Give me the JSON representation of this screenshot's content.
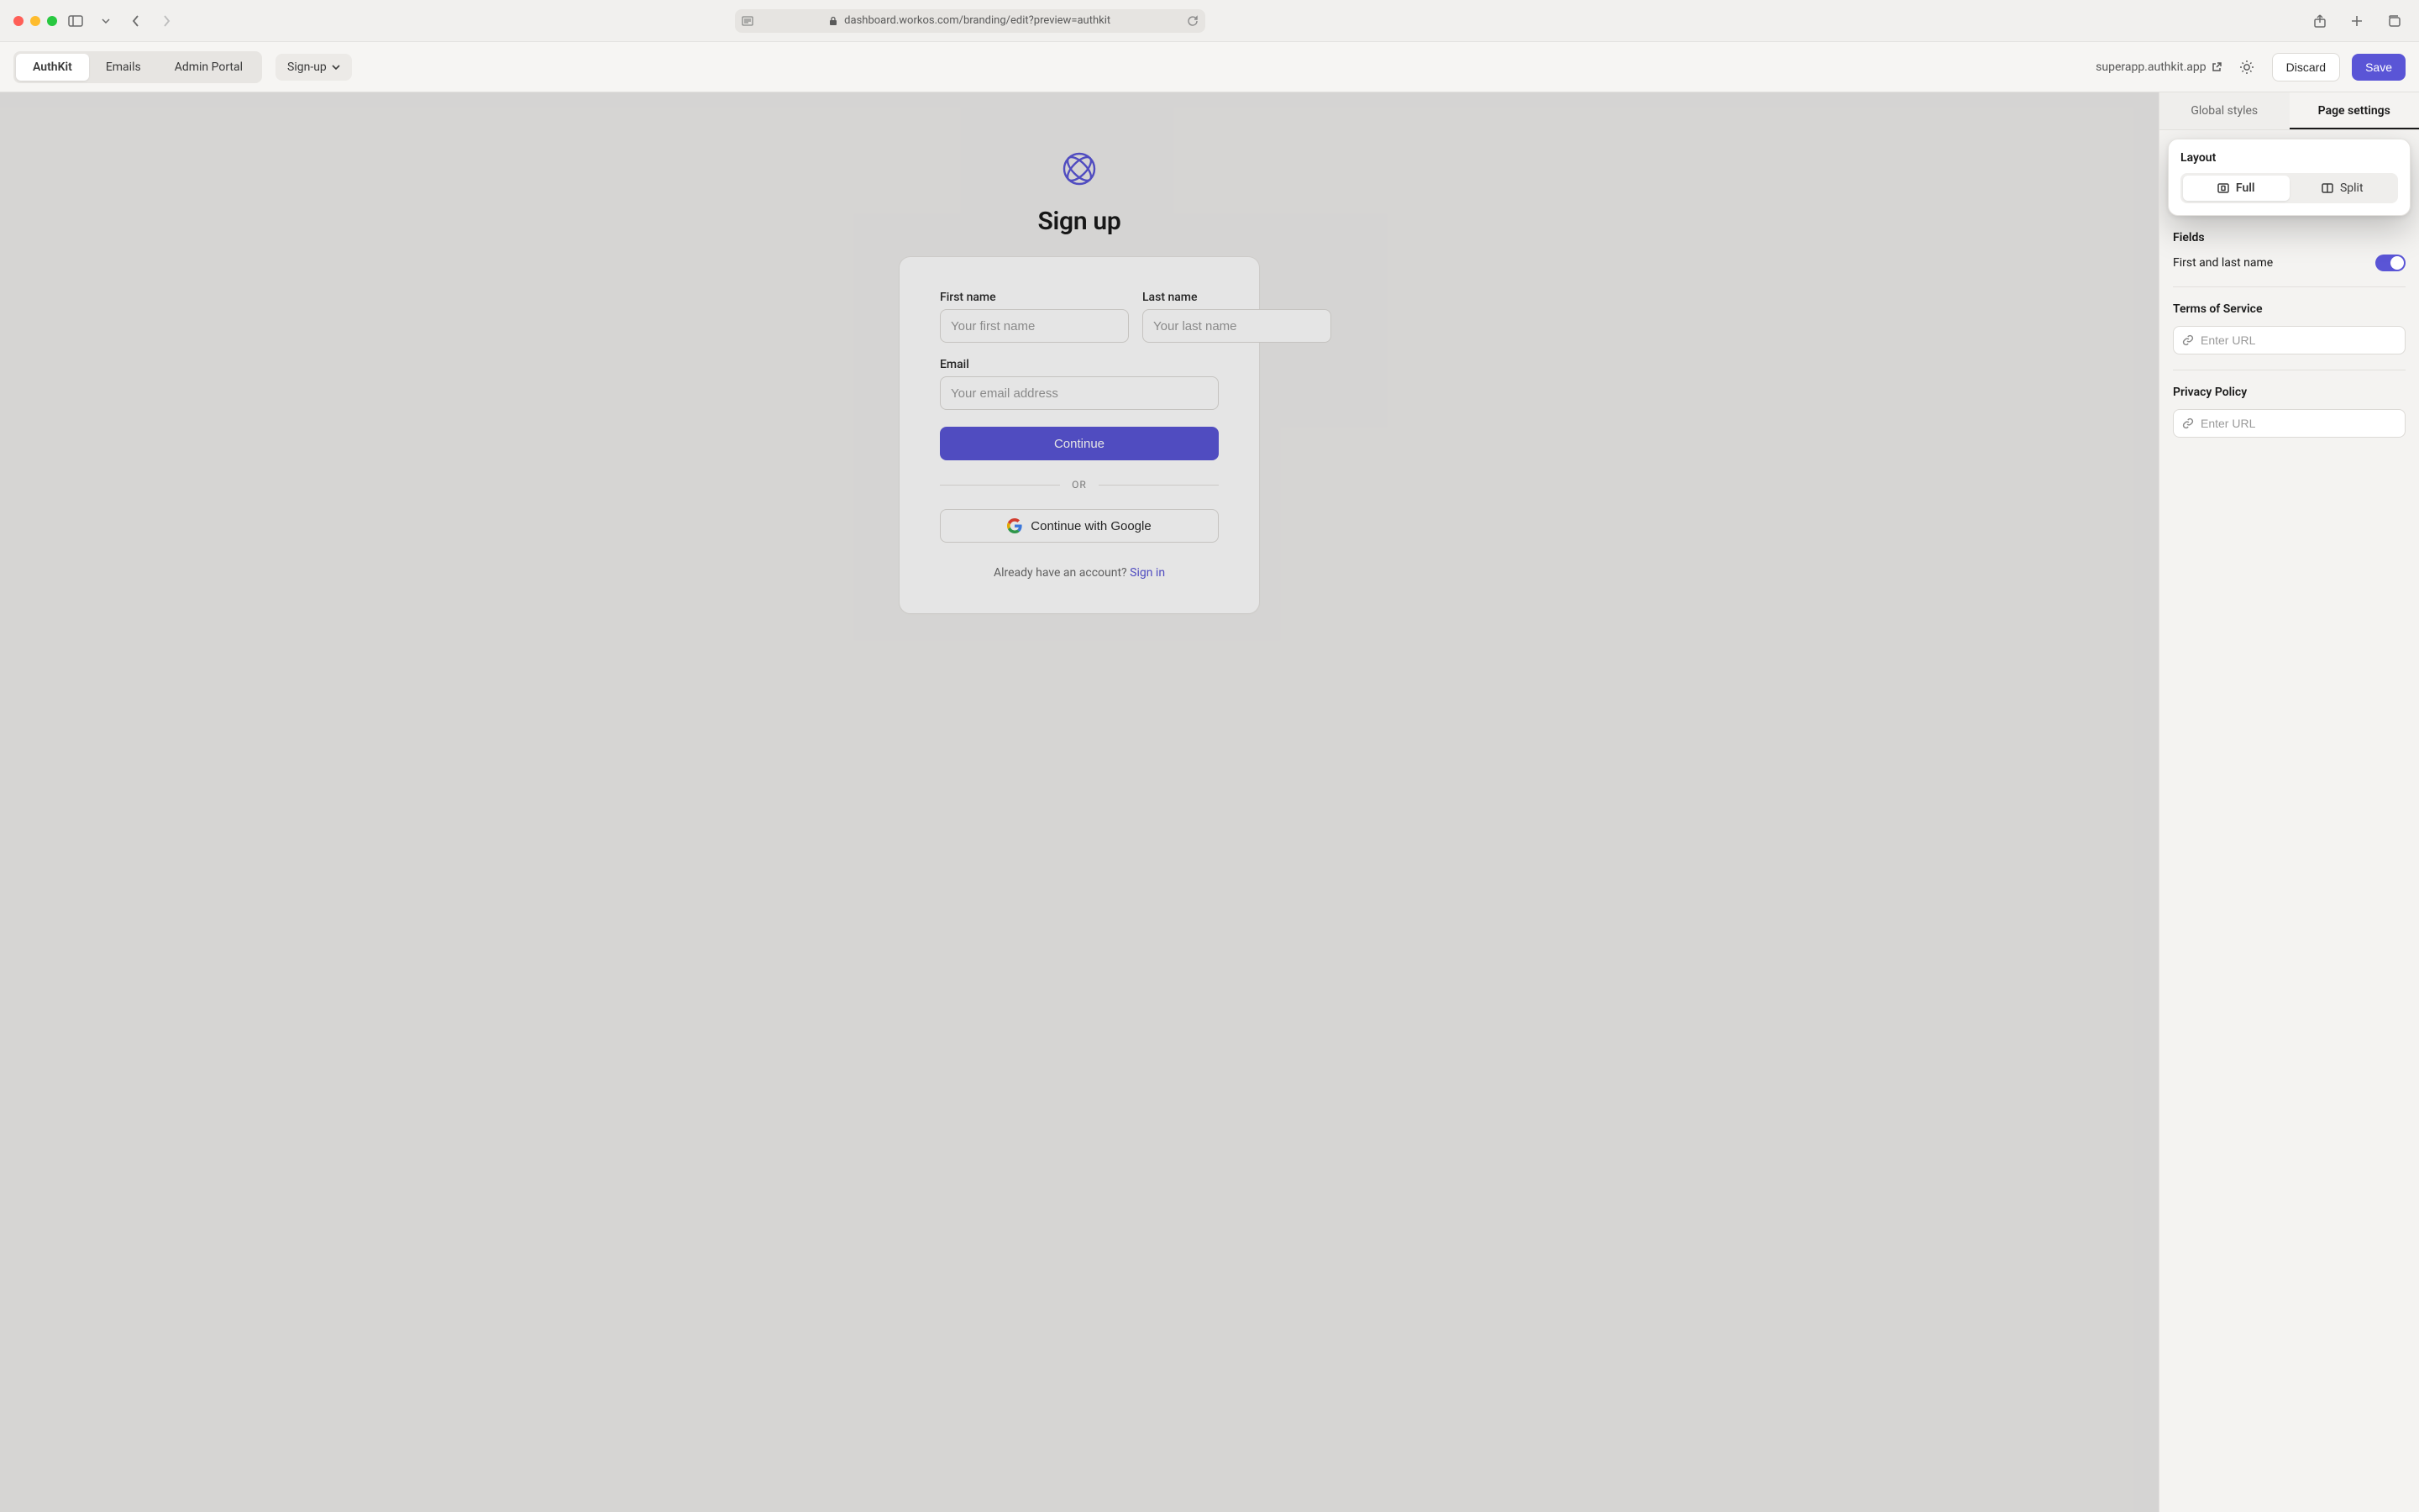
{
  "chrome": {
    "url": "dashboard.workos.com/branding/edit?preview=authkit"
  },
  "toolbar": {
    "tabs": [
      "AuthKit",
      "Emails",
      "Admin Portal"
    ],
    "active_tab_index": 0,
    "page_selector": "Sign-up",
    "app_url": "superapp.authkit.app",
    "discard": "Discard",
    "save": "Save"
  },
  "preview": {
    "title": "Sign up",
    "first_name_label": "First name",
    "first_name_placeholder": "Your first name",
    "last_name_label": "Last name",
    "last_name_placeholder": "Your last name",
    "email_label": "Email",
    "email_placeholder": "Your email address",
    "continue": "Continue",
    "or": "OR",
    "google": "Continue with Google",
    "already_prompt": "Already have an account? ",
    "signin": "Sign in"
  },
  "sidebar": {
    "tabs": {
      "global": "Global styles",
      "page": "Page settings"
    },
    "layout": {
      "title": "Layout",
      "full": "Full",
      "split": "Split",
      "active": "full"
    },
    "fields": {
      "title": "Fields",
      "first_last": "First and last name",
      "first_last_on": true
    },
    "tos": {
      "title": "Terms of Service",
      "placeholder": "Enter URL",
      "value": ""
    },
    "privacy": {
      "title": "Privacy Policy",
      "placeholder": "Enter URL",
      "value": ""
    }
  }
}
